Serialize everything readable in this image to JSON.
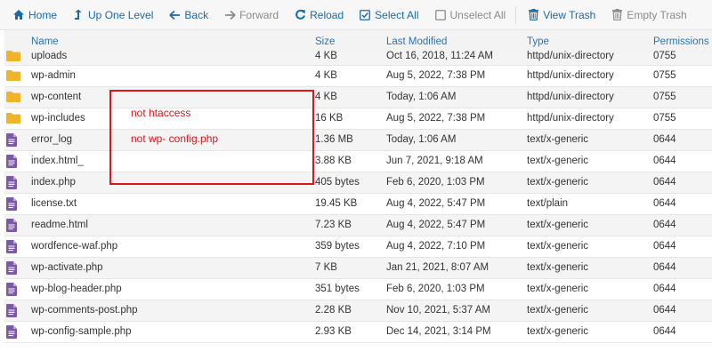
{
  "toolbar": {
    "home": "Home",
    "up": "Up One Level",
    "back": "Back",
    "forward": "Forward",
    "reload": "Reload",
    "select_all": "Select All",
    "unselect_all": "Unselect All",
    "view_trash": "View Trash",
    "empty_trash": "Empty Trash"
  },
  "columns": {
    "name": "Name",
    "size": "Size",
    "modified": "Last Modified",
    "type": "Type",
    "permissions": "Permissions"
  },
  "files": [
    {
      "kind": "folder",
      "name": "uploads",
      "size": "4 KB",
      "modified": "Oct 16, 2018, 11:24 AM",
      "type": "httpd/unix-directory",
      "perm": "0755"
    },
    {
      "kind": "folder",
      "name": "wp-admin",
      "size": "4 KB",
      "modified": "Aug 5, 2022, 7:38 PM",
      "type": "httpd/unix-directory",
      "perm": "0755"
    },
    {
      "kind": "folder",
      "name": "wp-content",
      "size": "4 KB",
      "modified": "Today, 1:06 AM",
      "type": "httpd/unix-directory",
      "perm": "0755"
    },
    {
      "kind": "folder",
      "name": "wp-includes",
      "size": "16 KB",
      "modified": "Aug 5, 2022, 7:38 PM",
      "type": "httpd/unix-directory",
      "perm": "0755"
    },
    {
      "kind": "file",
      "name": "error_log",
      "size": "1.36 MB",
      "modified": "Today, 1:06 AM",
      "type": "text/x-generic",
      "perm": "0644"
    },
    {
      "kind": "file",
      "name": "index.html_",
      "size": "3.88 KB",
      "modified": "Jun 7, 2021, 9:18 AM",
      "type": "text/x-generic",
      "perm": "0644"
    },
    {
      "kind": "file",
      "name": "index.php",
      "size": "405 bytes",
      "modified": "Feb 6, 2020, 1:03 PM",
      "type": "text/x-generic",
      "perm": "0644"
    },
    {
      "kind": "file",
      "name": "license.txt",
      "size": "19.45 KB",
      "modified": "Aug 4, 2022, 5:47 PM",
      "type": "text/plain",
      "perm": "0644"
    },
    {
      "kind": "file",
      "name": "readme.html",
      "size": "7.23 KB",
      "modified": "Aug 4, 2022, 5:47 PM",
      "type": "text/x-generic",
      "perm": "0644"
    },
    {
      "kind": "file",
      "name": "wordfence-waf.php",
      "size": "359 bytes",
      "modified": "Aug 4, 2022, 7:10 PM",
      "type": "text/x-generic",
      "perm": "0644"
    },
    {
      "kind": "file",
      "name": "wp-activate.php",
      "size": "7 KB",
      "modified": "Jan 21, 2021, 8:07 AM",
      "type": "text/x-generic",
      "perm": "0644"
    },
    {
      "kind": "file",
      "name": "wp-blog-header.php",
      "size": "351 bytes",
      "modified": "Feb 6, 2020, 1:03 PM",
      "type": "text/x-generic",
      "perm": "0644"
    },
    {
      "kind": "file",
      "name": "wp-comments-post.php",
      "size": "2.28 KB",
      "modified": "Nov 10, 2021, 5:37 AM",
      "type": "text/x-generic",
      "perm": "0644"
    },
    {
      "kind": "file",
      "name": "wp-config-sample.php",
      "size": "2.93 KB",
      "modified": "Dec 14, 2021, 3:14 PM",
      "type": "text/x-generic",
      "perm": "0644"
    }
  ],
  "annotation": {
    "line1": "not htaccess",
    "line2": "not wp- config.php",
    "color": "#e0141a"
  },
  "colors": {
    "accent": "#1a6aa8",
    "folder": "#f0b429",
    "file": "#7a5aa6"
  }
}
